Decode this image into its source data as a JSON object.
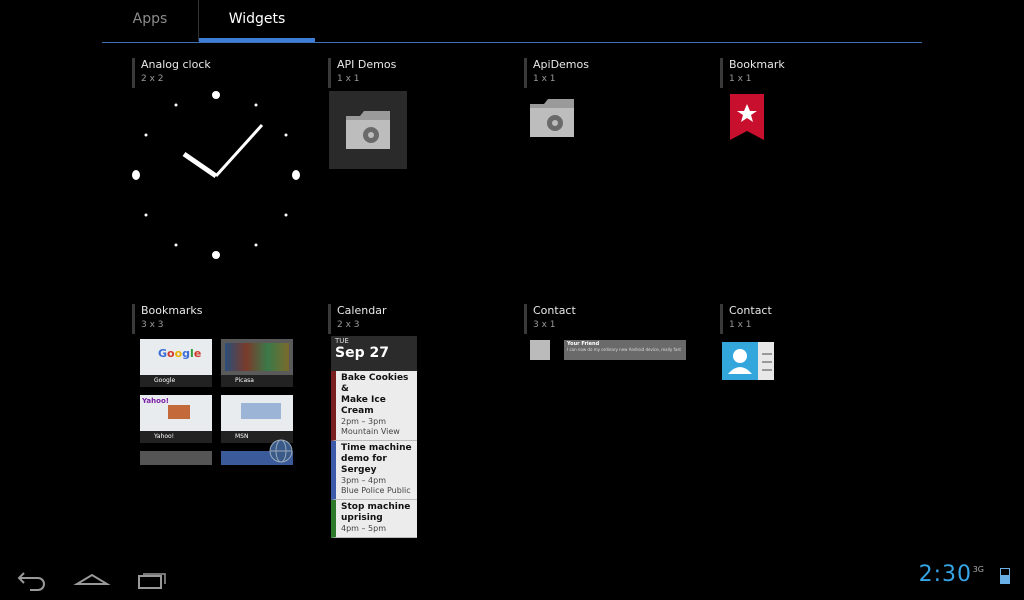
{
  "tabs": {
    "apps": "Apps",
    "widgets": "Widgets"
  },
  "widgets": [
    {
      "title": "Analog clock",
      "size": "2 x 2"
    },
    {
      "title": "API Demos",
      "size": "1 x 1"
    },
    {
      "title": "ApiDemos",
      "size": "1 x 1"
    },
    {
      "title": "Bookmark",
      "size": "1 x 1"
    },
    {
      "title": "Bookmarks",
      "size": "3 x 3"
    },
    {
      "title": "Calendar",
      "size": "2 x 3"
    },
    {
      "title": "Contact",
      "size": "3 x 1"
    },
    {
      "title": "Contact",
      "size": "1 x 1"
    }
  ],
  "bookmarks_preview": [
    "Google",
    "Picasa",
    "Yahoo!",
    "MSN"
  ],
  "calendar_preview": {
    "dow": "TUE",
    "date": "Sep 27",
    "events": [
      {
        "title": "Bake Cookies &\nMake Ice Cream",
        "time": "2pm – 3pm",
        "place": "Mountain View",
        "color": "#7a1f1f"
      },
      {
        "title": "Time machine\ndemo for Sergey",
        "time": "3pm – 4pm",
        "place": "Blue Police Public",
        "color": "#3d5ba8"
      },
      {
        "title": "Stop machine\nuprising",
        "time": "4pm – 5pm",
        "place": "",
        "color": "#2d7a2d"
      }
    ]
  },
  "contact_preview": {
    "name": "Your Friend",
    "status": "I can now do my ordinary new Android device, really fast"
  },
  "status": {
    "time": "2:30",
    "signal": "3G"
  },
  "nav_icons": [
    "back-icon",
    "home-icon",
    "recent-apps-icon"
  ],
  "colors": {
    "accent": "#3d7fd6",
    "clock": "#36a5e8",
    "bookmark_red": "#c8102e"
  }
}
